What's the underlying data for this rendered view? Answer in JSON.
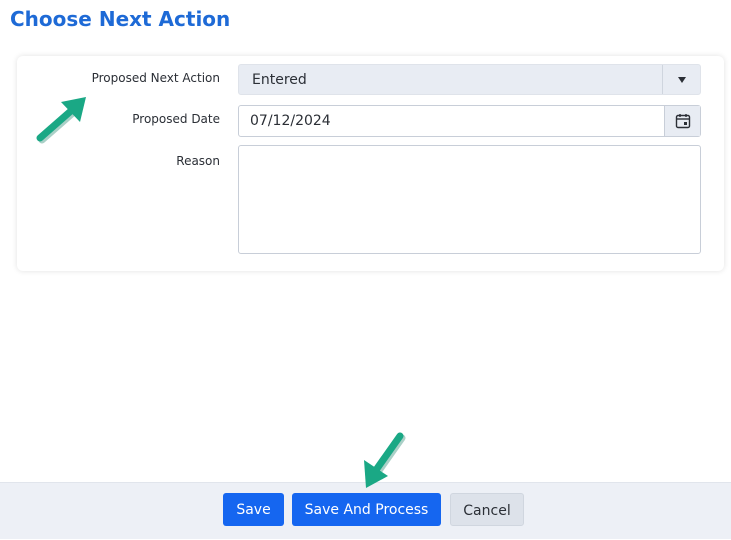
{
  "page": {
    "title": "Choose Next Action"
  },
  "form": {
    "proposed_next_action": {
      "label": "Proposed Next Action",
      "value": "Entered",
      "icon": "chevron-down-icon"
    },
    "proposed_date": {
      "label": "Proposed Date",
      "value": "07/12/2024",
      "icon": "calendar-icon"
    },
    "reason": {
      "label": "Reason",
      "value": ""
    }
  },
  "footer": {
    "save_label": "Save",
    "save_and_process_label": "Save And Process",
    "cancel_label": "Cancel"
  },
  "colors": {
    "title": "#1e6ad6",
    "primary_button": "#1566f0",
    "annotation_arrow": "#1aa885"
  }
}
